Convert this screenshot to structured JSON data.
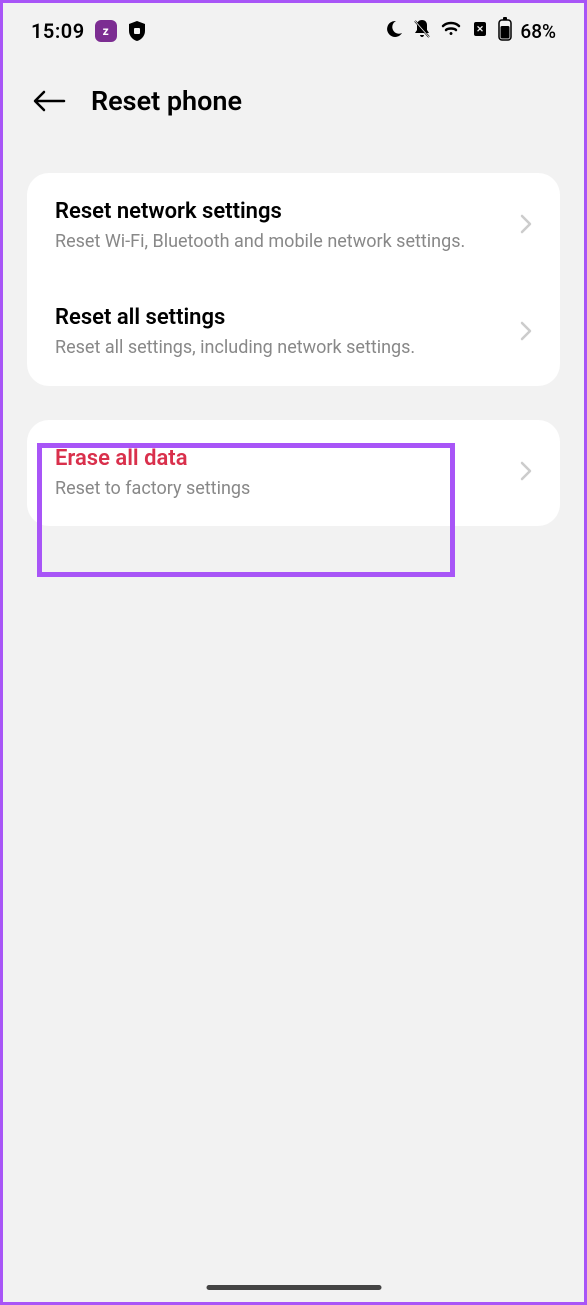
{
  "statusBar": {
    "time": "15:09",
    "batteryPercent": "68%"
  },
  "header": {
    "title": "Reset phone"
  },
  "group1": {
    "items": [
      {
        "title": "Reset network settings",
        "subtitle": "Reset Wi-Fi, Bluetooth and mobile network settings."
      },
      {
        "title": "Reset all settings",
        "subtitle": "Reset all settings, including network settings."
      }
    ]
  },
  "group2": {
    "items": [
      {
        "title": "Erase all data",
        "subtitle": "Reset to factory settings"
      }
    ]
  }
}
